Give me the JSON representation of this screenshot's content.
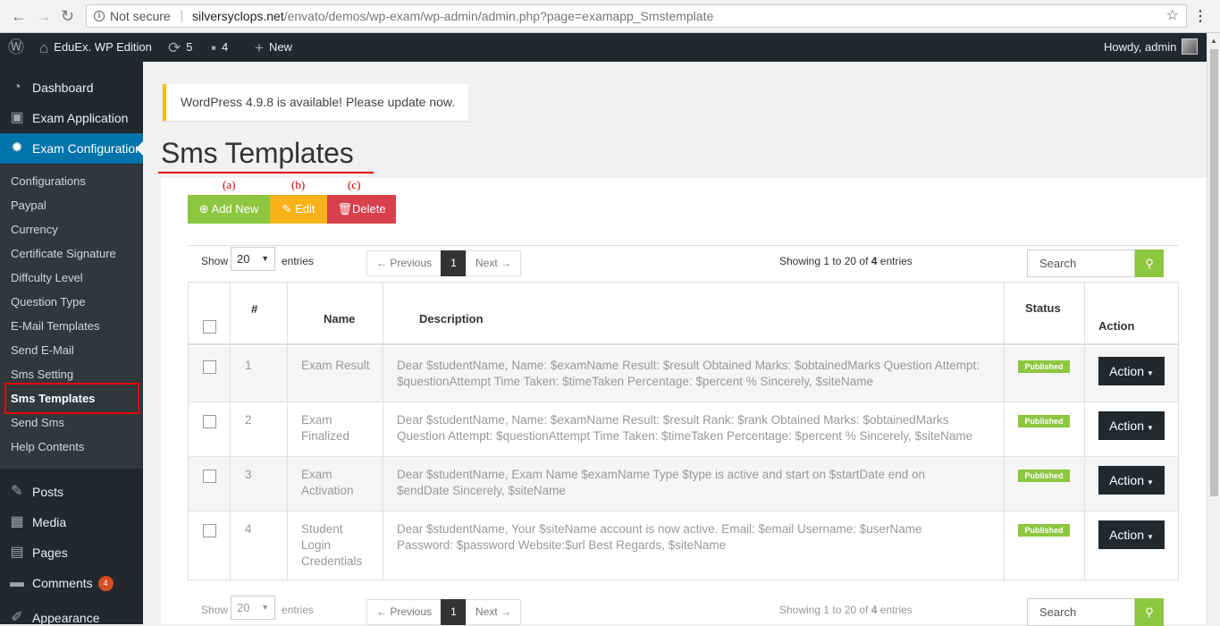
{
  "browser": {
    "back_icon": "arrow-left-icon",
    "forward_icon": "arrow-right-icon",
    "reload_icon": "reload-icon",
    "security": "Not secure",
    "url_domain": "silversyclops.net",
    "url_path": "/envato/demos/wp-exam/wp-admin/admin.php?page=examapp_Smstemplate"
  },
  "adminbar": {
    "site_name": "EduEx. WP Edition",
    "updates": "5",
    "comments": "4",
    "new_label": "New",
    "howdy": "Howdy, admin"
  },
  "sidebar": {
    "top": [
      {
        "label": "Dashboard",
        "icon": "dashboard-icon"
      },
      {
        "label": "Exam Application",
        "icon": "id-card-icon"
      },
      {
        "label": "Exam Configuration",
        "icon": "gear-icon"
      }
    ],
    "sub": [
      "Configurations",
      "Paypal",
      "Currency",
      "Certificate Signature",
      "Diffculty Level",
      "Question Type",
      "E-Mail Templates",
      "Send E-Mail",
      "Sms Setting",
      "Sms Templates",
      "Send Sms",
      "Help Contents"
    ],
    "bottom": [
      {
        "label": "Posts",
        "icon": "pin-icon"
      },
      {
        "label": "Media",
        "icon": "media-icon"
      },
      {
        "label": "Pages",
        "icon": "pages-icon"
      },
      {
        "label": "Comments",
        "icon": "comment-icon",
        "badge": "4"
      },
      {
        "label": "Appearance",
        "icon": "brush-icon"
      }
    ]
  },
  "notice": "WordPress 4.9.8 is available! Please update now.",
  "title": "Sms Templates",
  "annotations": [
    "(a)",
    "(b)",
    "(c)"
  ],
  "buttons": {
    "add": "Add New",
    "edit": "Edit",
    "delete": "Delete"
  },
  "controls": {
    "show": "Show",
    "entries_value": "20",
    "entries": "entries",
    "previous": "← Previous",
    "page": "1",
    "next": "Next →",
    "showing_pre": "Showing 1 to 20 of ",
    "showing_count": "4",
    "showing_post": " entries",
    "search_placeholder": "Search"
  },
  "table": {
    "headers": {
      "num": "#",
      "name": "Name",
      "description": "Description",
      "status": "Status",
      "action": "Action"
    },
    "rows": [
      {
        "num": "1",
        "name": "Exam Result",
        "description": "Dear $studentName, Name: $examName Result: $result Obtained Marks: $obtainedMarks Question Attempt: $questionAttempt Time Taken: $timeTaken Percentage: $percent % Sincerely, $siteName",
        "status": "Published",
        "action": "Action"
      },
      {
        "num": "2",
        "name": "Exam Finalized",
        "description": "Dear $studentName, Name: $examName Result: $result Rank: $rank Obtained Marks: $obtainedMarks Question Attempt: $questionAttempt Time Taken: $timeTaken Percentage: $percent % Sincerely, $siteName",
        "status": "Published",
        "action": "Action"
      },
      {
        "num": "3",
        "name": "Exam Activation",
        "description": "Dear $studentName, Exam Name $examName Type $type is active and start on $startDate end on $endDate Sincerely, $siteName",
        "status": "Published",
        "action": "Action"
      },
      {
        "num": "4",
        "name": "Student Login Credentials",
        "description": "Dear $studentName, Your $siteName account is now active. Email: $email Username: $userName Password: $password Website:$url Best Regards, $siteName",
        "status": "Published",
        "action": "Action"
      }
    ]
  },
  "colors": {
    "accent": "#0073aa",
    "add": "#8dc63f",
    "edit": "#f7b217",
    "delete": "#d9404e",
    "annotation": "#e60000"
  }
}
